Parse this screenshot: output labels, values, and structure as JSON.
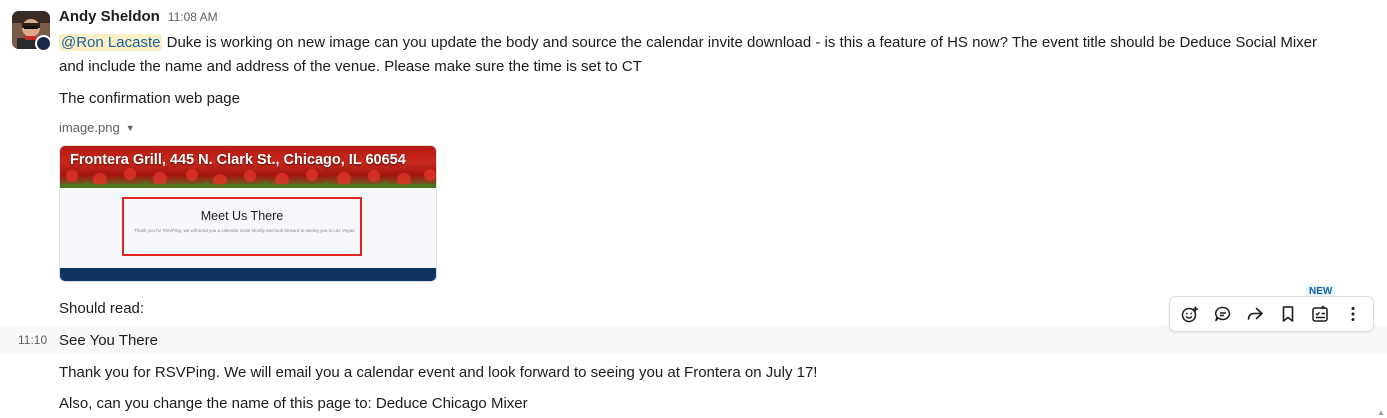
{
  "message": {
    "author": "Andy Sheldon",
    "time": "11:08 AM",
    "mention": "@Ron Lacaste",
    "line1_rest": " Duke is working on new image can you update the body and source the calendar invite download - is this a feature of HS now? The event title should be Deduce Social Mixer",
    "line2": "and include the name and address of the venue. Please make sure the time is set to CT",
    "line3": "The confirmation web page",
    "file_name": "image.png",
    "attachment": {
      "banner": "Frontera Grill, 445 N. Clark St., Chicago, IL 60654",
      "box_title": "Meet Us There",
      "box_text": "Thank you for RSVPing, we will send you a calendar invite shortly and look forward to seeing you in Las Vegas."
    },
    "should_read": "Should read:"
  },
  "followups": [
    {
      "time": "11:10",
      "text": "See You There"
    },
    {
      "text": "Thank you for RSVPing. We will email you a calendar event and look forward to seeing you at Frontera on July 17!"
    },
    {
      "text": "Also, can you change the name of this page to: Deduce Chicago Mixer"
    }
  ],
  "toolbar": {
    "new_badge": "NEW",
    "actions": [
      "add-reaction-icon",
      "reply-in-thread-icon",
      "forward-icon",
      "save-bookmark-icon",
      "add-to-list-icon",
      "more-actions-icon"
    ]
  }
}
